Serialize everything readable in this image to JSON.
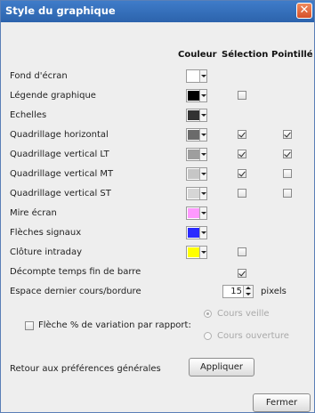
{
  "window": {
    "title": "Style du graphique",
    "close_glyph": "✕"
  },
  "columns": {
    "couleur": "Couleur",
    "selection": "Sélection",
    "pointille": "Pointillé"
  },
  "rows": [
    {
      "label": "Fond d'écran",
      "color": "#ffffff"
    },
    {
      "label": "Légende graphique",
      "color": "#000000",
      "selection": false
    },
    {
      "label": "Echelles",
      "color": "#333333"
    },
    {
      "label": "Quadrillage horizontal",
      "color": "#6b6b6b",
      "selection": true,
      "pointille": true
    },
    {
      "label": "Quadrillage vertical LT",
      "color": "#9e9e9e",
      "selection": true,
      "pointille": true
    },
    {
      "label": "Quadrillage vertical MT",
      "color": "#c6c6c6",
      "selection": true,
      "pointille": false
    },
    {
      "label": "Quadrillage vertical ST",
      "color": "#d6d6d6",
      "selection": false,
      "pointille": false
    },
    {
      "label": "Mire écran",
      "color": "#ff99ff"
    },
    {
      "label": "Flèches signaux",
      "color": "#2a2aff"
    },
    {
      "label": "Clôture intraday",
      "color": "#ffff00",
      "selection": false
    }
  ],
  "decompte": {
    "label": "Décompte temps fin de barre",
    "checked": true
  },
  "espace": {
    "label": "Espace dernier cours/bordure",
    "value": "15",
    "unit": "pixels"
  },
  "fleche": {
    "label": "Flèche % de variation par rapport:",
    "checked": false
  },
  "radios": [
    {
      "label": "Cours veille",
      "selected": true
    },
    {
      "label": "Cours ouverture",
      "selected": false
    }
  ],
  "retour": {
    "label": "Retour aux préférences générales",
    "button": "Appliquer"
  },
  "fermer": "Fermer"
}
